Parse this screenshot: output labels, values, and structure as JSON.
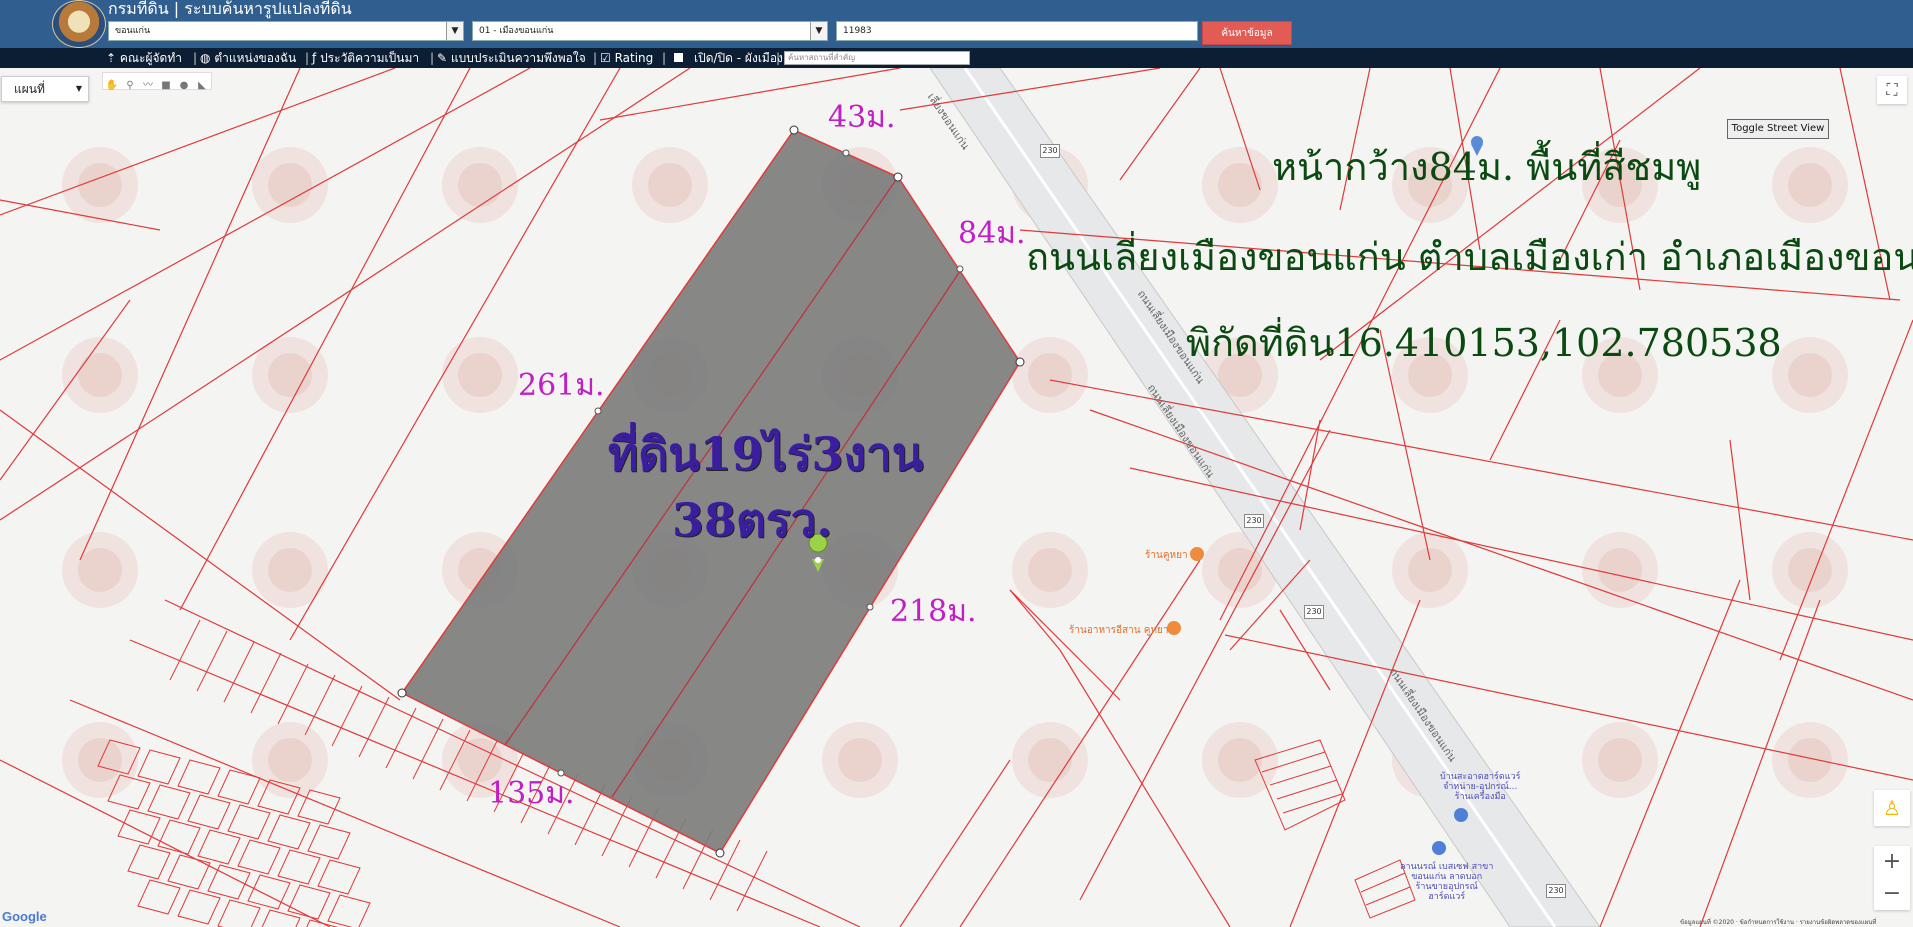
{
  "header": {
    "app_title": "กรมที่ดิน | ระบบค้นหารูปแปลงที่ดิน",
    "province_select": "ขอนแก่น",
    "district_select": "01 - เมืองขอนแก่น",
    "parcel_number": "11983",
    "search_button": "ค้นหาข้อมูล"
  },
  "toolbar": {
    "committee": "คณะผู้จัดทำ",
    "my_location": "ตำแหน่งของฉัน",
    "history": "ประวัติความเป็นมา",
    "survey": "แบบประเมินความพึงพอใจ",
    "rating": "Rating",
    "city_toggle": "เปิด/ปิด - ผังเมือง",
    "place_placeholder": "ค้นหาสถานที่สำคัญ"
  },
  "map_controls": {
    "map_type": "แผนที่",
    "street_view_toggle": "Toggle Street View",
    "zoom_in": "+",
    "zoom_out": "−",
    "google": "Google",
    "attribution": "ข้อมูลแผนที่ ©2020 · ข้อกำหนดการใช้งาน · รายงานข้อผิดพลาดของแผนที่"
  },
  "annotations": {
    "dim_top": "43ม.",
    "dim_upper_right": "84ม.",
    "dim_left": "261ม.",
    "dim_right": "218ม.",
    "dim_bottom": "135ม.",
    "area_line1": "ที่ดิน19ไร่3งาน",
    "area_line2": "38ตรว.",
    "frontage": "หน้ากว้าง84ม. พื้นที่สีชมพู",
    "address": "ถนนเลี่ยงเมืองขอนแก่น ตำบลเมืองเก่า อำเภอเมืองขอนแก่น ขอนแก่น",
    "coordinates": "พิกัดที่ดิน16.410153,102.780538"
  },
  "map_labels": {
    "road_name": "ถนนเลี่ยงเมืองขอนแก่น",
    "road_top": "เลี่ยงขอนแก่น",
    "route_number": "230",
    "poi_1": "ร้านคูหยา",
    "poi_2": "ร้านอาหารอีสาน คูหยา",
    "poi_3_line1": "บ้านสะอาดฮาร์ดแวร์",
    "poi_3_line2": "จำหน่าย-อุปกรณ์...",
    "poi_3_line3": "ร้านเครื่องมือ",
    "poi_4_line1": "ลานนรณ์ เบสเซฟ สาขา",
    "poi_4_line2": "ขอนแก่น ลาดบอก",
    "poi_4_line3": "ร้านขายอุปกรณ์",
    "poi_4_line4": "ฮาร์ดแวร์"
  },
  "colors": {
    "header_bg": "#2f5e8f",
    "toolbar_bg": "#0c1e33",
    "search_button_bg": "#e25b55",
    "parcel_fill": "#7d7d7d",
    "parcel_lines": "#e03a3a",
    "dimension_text": "#c21ec6",
    "info_text": "#0a4a10"
  }
}
